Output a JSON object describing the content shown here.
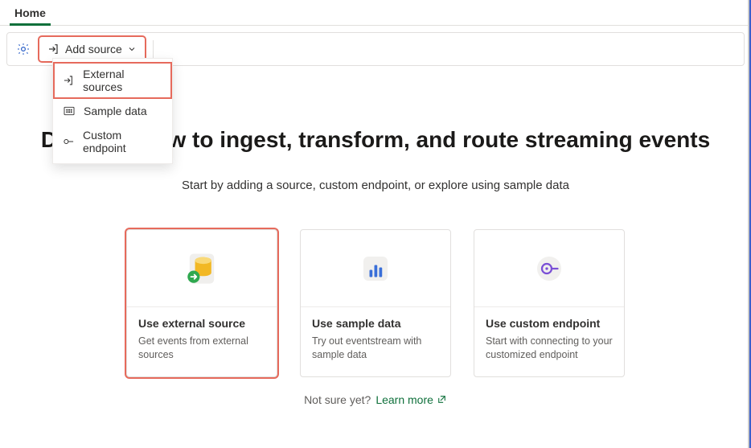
{
  "tab": {
    "home": "Home"
  },
  "toolbar": {
    "add_source": "Add source"
  },
  "dropdown": {
    "items": [
      {
        "label": "External sources"
      },
      {
        "label": "Sample data"
      },
      {
        "label": "Custom endpoint"
      }
    ]
  },
  "hero": {
    "title": "Design a flow to ingest, transform, and route streaming events",
    "subtitle": "Start by adding a source, custom endpoint, or explore using sample data"
  },
  "cards": [
    {
      "title": "Use external source",
      "desc": "Get events from external sources"
    },
    {
      "title": "Use sample data",
      "desc": "Try out eventstream with sample data"
    },
    {
      "title": "Use custom endpoint",
      "desc": "Start with connecting to your customized endpoint"
    }
  ],
  "footer": {
    "not_sure": "Not sure yet?",
    "learn_more": "Learn more"
  }
}
